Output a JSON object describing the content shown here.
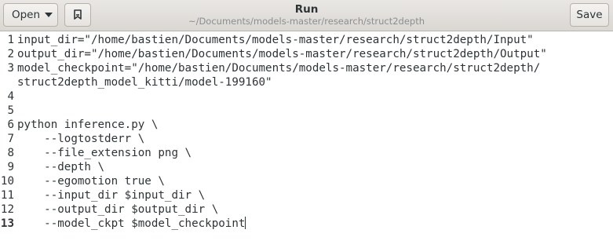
{
  "header": {
    "open_label": "Open",
    "title": "Run",
    "subtitle": "~/Documents/models-master/research/struct2depth",
    "save_label": "Save"
  },
  "editor": {
    "current_line": "13",
    "lines": [
      {
        "num": "1",
        "text": "input_dir=\"/home/bastien/Documents/models-master/research/struct2depth/Input\""
      },
      {
        "num": "2",
        "text": "output_dir=\"/home/bastien/Documents/models-master/research/struct2depth/Output\""
      },
      {
        "num": "3",
        "text": "model_checkpoint=\"/home/bastien/Documents/models-master/research/struct2depth/"
      },
      {
        "num": "",
        "text": "struct2depth_model_kitti/model-199160\""
      },
      {
        "num": "4",
        "text": ""
      },
      {
        "num": "5",
        "text": ""
      },
      {
        "num": "6",
        "text": "python inference.py \\"
      },
      {
        "num": "7",
        "text": "    --logtostderr \\"
      },
      {
        "num": "8",
        "text": "    --file_extension png \\"
      },
      {
        "num": "9",
        "text": "    --depth \\"
      },
      {
        "num": "10",
        "text": "    --egomotion true \\"
      },
      {
        "num": "11",
        "text": "    --input_dir $input_dir \\"
      },
      {
        "num": "12",
        "text": "    --output_dir $output_dir \\"
      },
      {
        "num": "13",
        "text": "    --model_ckpt $model_checkpoint"
      }
    ]
  }
}
